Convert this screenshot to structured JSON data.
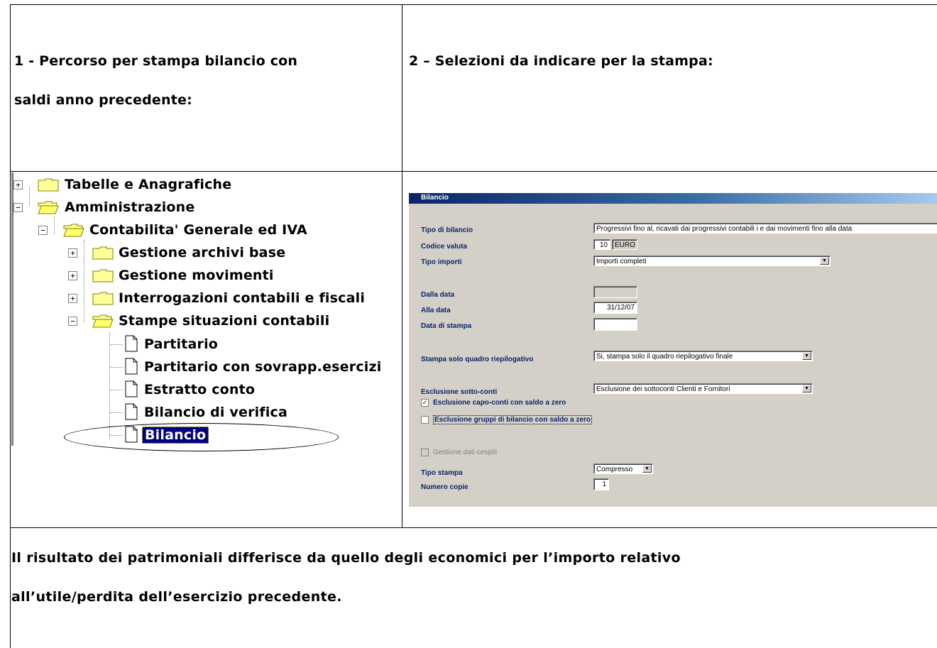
{
  "section1": {
    "heading_line1": "1 - Percorso per stampa bilancio con",
    "heading_line2": "saldi anno precedente:"
  },
  "section2": {
    "heading": "2 – Selezioni da indicare per la stampa:"
  },
  "tree": {
    "items": [
      {
        "label": "Tabelle e Anagrafiche",
        "expander": "+",
        "icon": "folder-closed-icon"
      },
      {
        "label": "Amministrazione",
        "expander": "−",
        "icon": "folder-open-icon"
      },
      {
        "label": "Contabilita' Generale ed IVA",
        "expander": "−",
        "icon": "folder-open-icon"
      },
      {
        "label": "Gestione archivi base",
        "expander": "+",
        "icon": "folder-closed-icon"
      },
      {
        "label": "Gestione movimenti",
        "expander": "+",
        "icon": "folder-closed-icon"
      },
      {
        "label": "Interrogazioni contabili e fiscali",
        "expander": "+",
        "icon": "folder-closed-icon"
      },
      {
        "label": "Stampe situazioni contabili",
        "expander": "−",
        "icon": "folder-open-icon"
      },
      {
        "label": "Partitario",
        "icon": "document-icon"
      },
      {
        "label": "Partitario con sovrapp.esercizi",
        "icon": "document-icon"
      },
      {
        "label": "Estratto conto",
        "icon": "document-icon"
      },
      {
        "label": "Bilancio di verifica",
        "icon": "document-icon"
      },
      {
        "label": "Bilancio",
        "icon": "document-icon",
        "selected": true
      }
    ]
  },
  "dialog": {
    "title": "Bilancio",
    "tipo_bilancio": {
      "label": "Tipo di bilancio",
      "value": "Progressivi fino al, ricavati dai progressivi contabili i e dai movimenti fino alla data"
    },
    "codice_valuta": {
      "label": "Codice valuta",
      "code": "10",
      "name": "EURO"
    },
    "tipo_importi": {
      "label": "Tipo importi",
      "value": "Importi completi"
    },
    "dalla_data": {
      "label": "Dalla data",
      "value": ""
    },
    "alla_data": {
      "label": "Alla data",
      "value": "31/12/07"
    },
    "data_stampa": {
      "label": "Data di stampa",
      "value": ""
    },
    "stampa_quadro": {
      "label": "Stampa solo quadro riepilogativo",
      "value": "Si, stampa solo il quadro riepilogativo finale"
    },
    "esclusione_sottoconti": {
      "label": "Esclusione sotto-conti",
      "value": "Esclusione dei sottoconti Clienti e Fornitori"
    },
    "chk_capo_conti": {
      "label": "Esclusione capo-conti con saldo a zero",
      "mark": "✓"
    },
    "chk_gruppi": {
      "label": "Esclusione gruppi di bilancio con saldo a zero",
      "mark": ""
    },
    "chk_cespiti": {
      "label": "Gestione dati cespiti",
      "mark": ""
    },
    "tipo_stampa": {
      "label": "Tipo stampa",
      "value": "Compresso"
    },
    "numero_copie": {
      "label": "Numero copie",
      "value": "1"
    },
    "dropdown_arrow": "▼"
  },
  "footer": {
    "line1": "Il risultato dei patrimoniali differisce da quello degli economici per l’importo relativo",
    "line2": "all’utile/perdita dell’esercizio precedente."
  }
}
